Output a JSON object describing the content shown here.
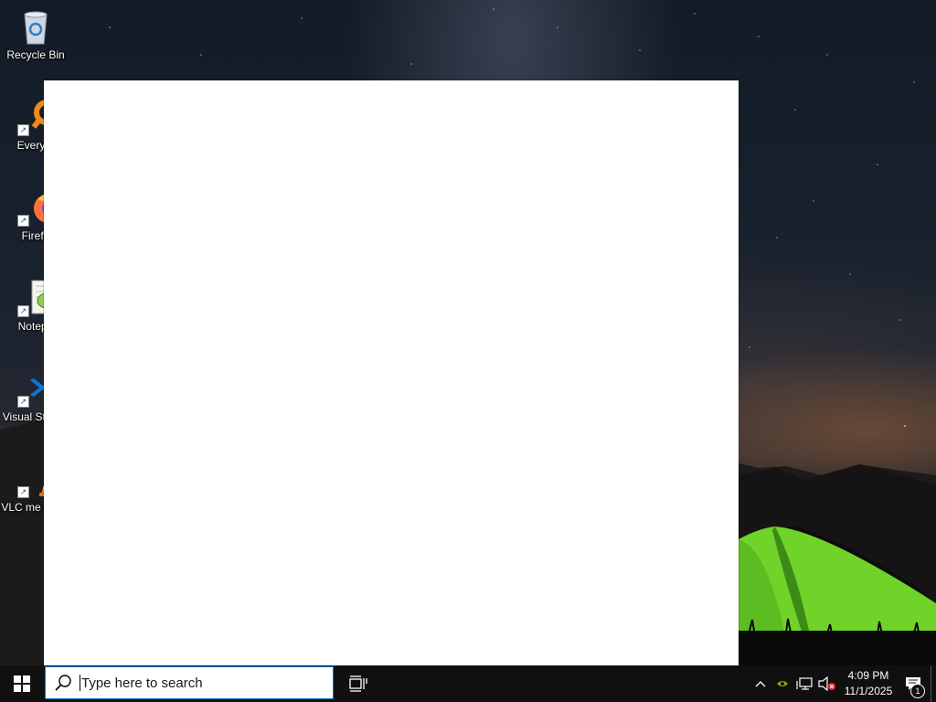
{
  "desktop": {
    "icons": [
      {
        "name": "recycle-bin",
        "label": "Recycle Bin"
      },
      {
        "name": "everything",
        "label": "Everyth"
      },
      {
        "name": "firefox",
        "label": "Firefo"
      },
      {
        "name": "notepad-plus-plus",
        "label": "Notepa"
      },
      {
        "name": "visual-studio-code",
        "label": "Visual St Cod"
      },
      {
        "name": "vlc-media-player",
        "label": "VLC me playe"
      }
    ]
  },
  "taskbar": {
    "start_icon": "windows-logo-icon",
    "search": {
      "placeholder": "Type here to search",
      "value": ""
    },
    "task_view_icon": "task-view-icon",
    "tray": {
      "icons": [
        "chevron-up-icon",
        "nvidia-icon",
        "network-icon",
        "volume-muted-icon"
      ],
      "clock": {
        "time": "4:09 PM",
        "date": "11/1/2025"
      },
      "notifications": {
        "count": "1"
      }
    }
  },
  "colors": {
    "taskbar": "#101010",
    "search_border": "#0078d7",
    "tent": "#6fd32a"
  }
}
